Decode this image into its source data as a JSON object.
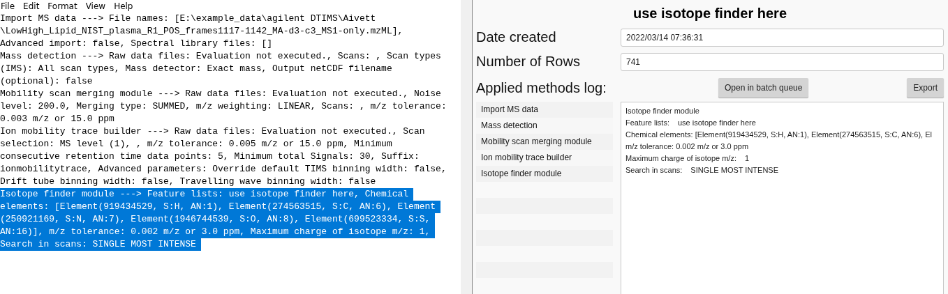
{
  "editor": {
    "menu": [
      "File",
      "Edit",
      "Format",
      "View",
      "Help"
    ],
    "paragraphs": [
      {
        "selected": false,
        "lines": [
          "Import MS data ---> File names: [E:\\example_data\\agilent DTIMS\\Aivett",
          "\\LowHigh_Lipid_NIST_plasma_R1_POS_frames1117-1142_MA-d3-c3_MS1-only.mzML],",
          "Advanced import: false, Spectral library files: []"
        ]
      },
      {
        "selected": false,
        "lines": [
          "Mass detection ---> Raw data files: Evaluation not executed., Scans: , Scan types",
          "(IMS): All scan types, Mass detector: Exact mass, Output netCDF filename",
          "(optional): false"
        ]
      },
      {
        "selected": false,
        "lines": [
          "Mobility scan merging module ---> Raw data files: Evaluation not executed., Noise",
          "level: 200.0, Merging type: SUMMED, m/z weighting: LINEAR, Scans: , m/z tolerance:",
          "0.003 m/z or 15.0 ppm"
        ]
      },
      {
        "selected": false,
        "lines": [
          "Ion mobility trace builder ---> Raw data files: Evaluation not executed., Scan",
          "selection: MS level (1), , m/z tolerance: 0.005 m/z or 15.0 ppm, Minimum",
          "consecutive retention time data points: 5, Minimum total Signals: 30, Suffix:",
          "ionmobilitytrace, Advanced parameters: Override default TIMS binning width: false,",
          "Drift tube binning width: false, Travelling wave binning width: false"
        ]
      },
      {
        "selected": true,
        "lines": [
          "Isotope finder module ---> Feature lists: use isotope finder here, Chemical",
          "elements: [Element(919434529, S:H, AN:1), Element(274563515, S:C, AN:6), Element",
          "(250921169, S:N, AN:7), Element(1946744539, S:O, AN:8), Element(699523334, S:S,",
          "AN:16)], m/z tolerance: 0.002 m/z or 3.0 ppm, Maximum charge of isotope m/z: 1,",
          "Search in scans: SINGLE MOST INTENSE"
        ]
      }
    ]
  },
  "panel": {
    "title": "use isotope finder here",
    "fields": [
      {
        "label": "Date created",
        "value": "2022/03/14 07:36:31"
      },
      {
        "label": "Number of Rows",
        "value": "741"
      }
    ],
    "log_label": "Applied methods log:",
    "buttons": [
      "Open in batch queue",
      "Export"
    ],
    "methods": [
      "Import MS data",
      "Mass detection",
      "Mobility scan merging module",
      "Ion mobility trace builder",
      "Isotope finder module"
    ],
    "details": {
      "header": "Isotope finder module",
      "rows": [
        {
          "label": "Feature lists:",
          "value": "use isotope finder here"
        },
        {
          "label": "Chemical elements: [Element(919434529, S:H, AN:1), Element(274563515, S:C, AN:6), El"
        },
        {
          "label": "m/z tolerance: 0.002 m/z or 3.0 ppm"
        },
        {
          "label": "Maximum charge of isotope m/z:",
          "value": "1"
        },
        {
          "label": "Search in scans:",
          "value": "SINGLE MOST INTENSE"
        }
      ]
    }
  }
}
